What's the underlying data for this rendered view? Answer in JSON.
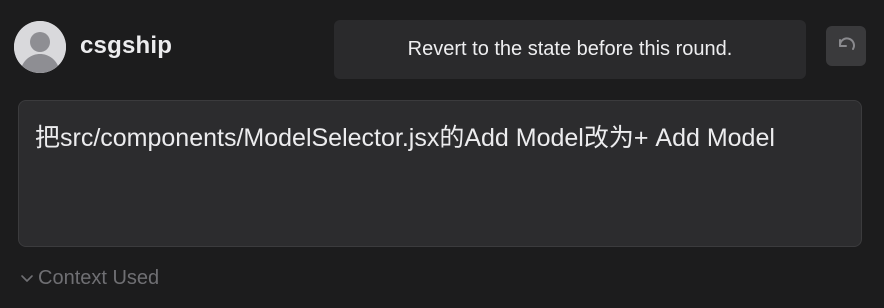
{
  "user": {
    "name": "csgship",
    "avatar_icon": "user-avatar-icon"
  },
  "tooltip": {
    "text": "Revert to the state before this round."
  },
  "revert_button": {
    "icon": "undo-icon"
  },
  "message": {
    "text": "把src/components/ModelSelector.jsx的Add Model改为+ Add Model"
  },
  "context": {
    "label": "Context Used",
    "icon": "chevron-down-icon"
  },
  "colors": {
    "background": "#1c1c1d",
    "message_box": "#2c2c2e",
    "tooltip": "#2a2a2c",
    "muted_text": "#6f6f73"
  }
}
